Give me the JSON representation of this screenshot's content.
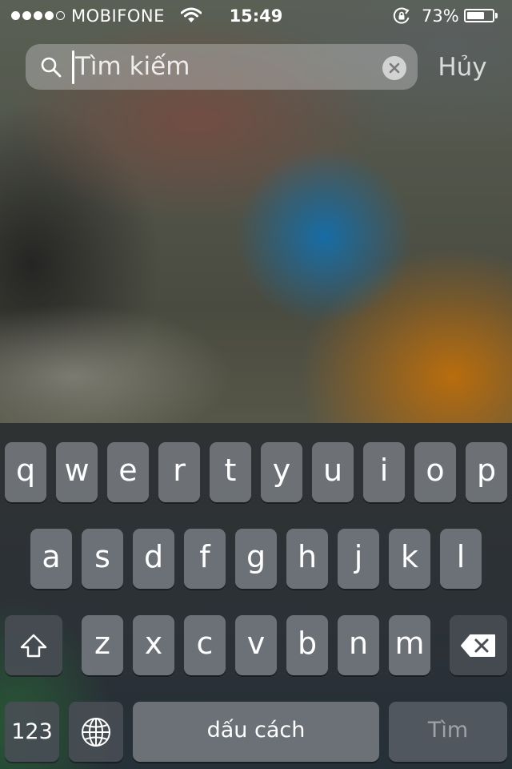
{
  "status_bar": {
    "carrier": "MOBIFONE",
    "time": "15:49",
    "battery_percent": "73%",
    "battery_level": 0.73,
    "signal_bars_filled": 4,
    "signal_bars_total": 5,
    "icons": [
      "signal-dots-icon",
      "wifi-icon",
      "rotation-lock-icon",
      "battery-icon"
    ]
  },
  "search": {
    "placeholder": "Tìm kiếm",
    "value": "",
    "cancel_label": "Hủy",
    "icons": [
      "search-icon",
      "clear-icon"
    ]
  },
  "keyboard": {
    "row1": [
      "q",
      "w",
      "e",
      "r",
      "t",
      "y",
      "u",
      "i",
      "o",
      "p"
    ],
    "row2": [
      "a",
      "s",
      "d",
      "f",
      "g",
      "h",
      "j",
      "k",
      "l"
    ],
    "row3": [
      "z",
      "x",
      "c",
      "v",
      "b",
      "n",
      "m"
    ],
    "shift_icon": "shift-arrow-icon",
    "backspace_icon": "backspace-icon",
    "globe_icon": "globe-icon",
    "numbers_label": "123",
    "space_label": "dấu cách",
    "search_label": "Tìm"
  },
  "colors": {
    "text": "#ffffff",
    "key": "#787c82",
    "key_dark": "#484e54",
    "keyboard_bg": "#2c3136"
  }
}
